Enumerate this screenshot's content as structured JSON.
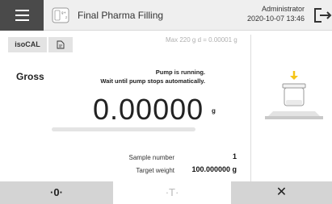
{
  "header": {
    "title": "Final Pharma Filling",
    "user": "Administrator",
    "datetime": "2020-10-07  13:46",
    "menu_icon": "hamburger-icon",
    "app_icon": "balance-device-icon",
    "logout_icon": "logout-icon"
  },
  "toolbar": {
    "iso_label": "isoCAL",
    "doc_icon": "document-icon",
    "capacity": "Max 220 g   d = 0.00001 g"
  },
  "main": {
    "mode_label": "Gross",
    "status_line1": "Pump is running.",
    "status_line2": "Wait until pump stops automatically.",
    "weight_value": "0.00000",
    "weight_unit": "g",
    "progress_fraction": 0.0
  },
  "info": {
    "sample_label": "Sample number",
    "sample_value": "1",
    "target_label": "Target weight",
    "target_value": "100.000000 g"
  },
  "footer": {
    "zero_label": "·0·",
    "tare_label": "·T·",
    "close_label": "✕"
  },
  "colors": {
    "header_bg": "#efefef",
    "menu_bg": "#4a4a4a",
    "footer_button_bg": "#d4d4d4",
    "arrow_accent": "#f5c518"
  }
}
